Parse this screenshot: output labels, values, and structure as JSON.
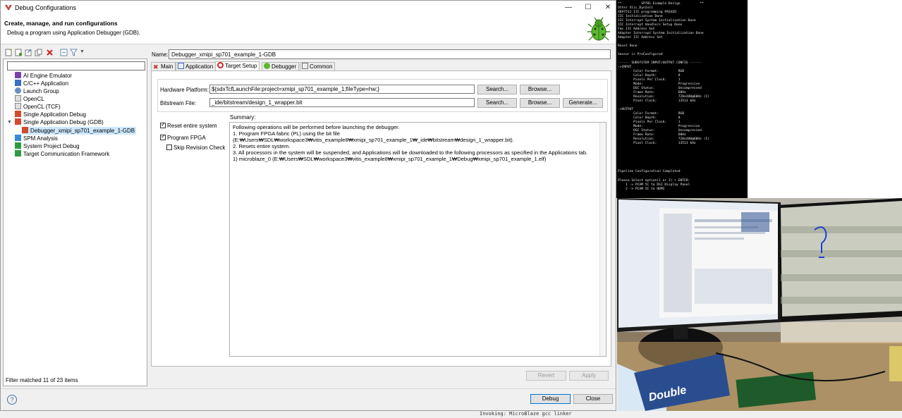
{
  "window": {
    "title": "Debug Configurations",
    "header_title": "Create, manage, and run configurations",
    "header_subtitle": "Debug a program using Application Debugger (GDB)."
  },
  "left": {
    "filter_value": "",
    "tree": [
      {
        "label": "AI Engine Emulator"
      },
      {
        "label": "C/C++ Application"
      },
      {
        "label": "Launch Group"
      },
      {
        "label": "OpenCL"
      },
      {
        "label": "OpenCL (TCF)"
      },
      {
        "label": "Single Application Debug"
      },
      {
        "label": "Single Application Debug (GDB)"
      },
      {
        "label": "Debugger_xmipi_sp701_example_1-GDB"
      },
      {
        "label": "SPM Analysis"
      },
      {
        "label": "System Project Debug"
      },
      {
        "label": "Target Communication Framework"
      }
    ],
    "filter_status": "Filter matched 11 of 23 items"
  },
  "config": {
    "name_label": "Name:",
    "name_value": "Debugger_xmipi_sp701_example_1-GDB",
    "tabs": [
      {
        "label": "Main"
      },
      {
        "label": "Application"
      },
      {
        "label": "Target Setup"
      },
      {
        "label": "Debugger"
      },
      {
        "label": "Common"
      }
    ],
    "hw_label": "Hardware Platform:",
    "hw_value": "${sdxTcfLaunchFile:project=xmipi_sp701_example_1;fileType=hw;}",
    "bit_label": "Bitstream File:",
    "bit_value": "_ide/bitstream/design_1_wrapper.bit",
    "search": "Search...",
    "browse": "Browse...",
    "generate": "Generate...",
    "reset_label": "Reset entire system",
    "program_label": "Program FPGA",
    "skip_label": "Skip Revision Check",
    "summary_label": "Summary:",
    "summary_lines": [
      "Following operations will be performed before launching the debugger.",
      "1. Program FPGA fabric (PL) using the bit file",
      "(E:₩Users₩SDL₩workspace3₩vitis_example8₩xmipi_sp701_example_1₩_ide₩bitstream₩design_1_wrapper.bit).",
      "2. Resets entire system.",
      "3. All processors in the system will be suspended, and Applications will be downloaded to the following processors as specified in the Applications tab.",
      "    1) microblaze_0 (E:₩Users₩SDL₩workspace3₩vitis_example8₩xmipi_sp701_example_1₩Debug₩xmipi_sp701_example_1.elf)"
    ],
    "revert": "Revert",
    "apply": "Apply",
    "debug": "Debug",
    "close": "Close"
  },
  "terminal": {
    "lines": [
      "**          SP701 Example Design          **",
      "Otter Xlic_DynInit",
      "ADV7511 IIC programming PASSED",
      "IIC Initialization Done",
      "IIC Interrupt System Initialization Done",
      "IIC Interrupt Handlers Setup Done",
      "Fmc IIC Address Set",
      "Adapter Interrupt System Initialization Done",
      "Adapter IIC Address Set",
      "",
      "Reset Done",
      "",
      "Sensor is PreConfigured",
      "",
      "------ SUBSYSTEM INPUT/OUTPUT CONFIG ------",
      "->INPUT",
      "        Color Format:          RGB",
      "        Color Depth:           8",
      "        Pixels Per Clock:      1",
      "        Mode:                  Progressive",
      "        DSC Status:            Uncompressed",
      "        Frame Rate:            60Hz",
      "        Resolution:            720x480@60Hz (I)",
      "        Pixel Clock:           13513 kHz",
      "",
      "->OUTPUT",
      "        Color Format:          RGB",
      "        Color Depth:           8",
      "        Pixels Per Clock:      1",
      "        Mode:                  Progressive",
      "        DSC Status:            Uncompressed",
      "        Frame Rate:            60Hz",
      "        Resolution:            720x480@60Hz (I)",
      "        Pixel Clock:           13513 kHz",
      "",
      "",
      "",
      "",
      "Pipeline Configuration Completed",
      "",
      "Please Select option(1 or 2) + ENTER:",
      "    1 -> PCAM 5C to DSI Display Panel",
      "    2 -> PCAM 5C to HDMI"
    ]
  },
  "photo": {
    "box_text": "Double"
  },
  "bottom_snippet": "Invoking: MicroBlaze gcc linker"
}
